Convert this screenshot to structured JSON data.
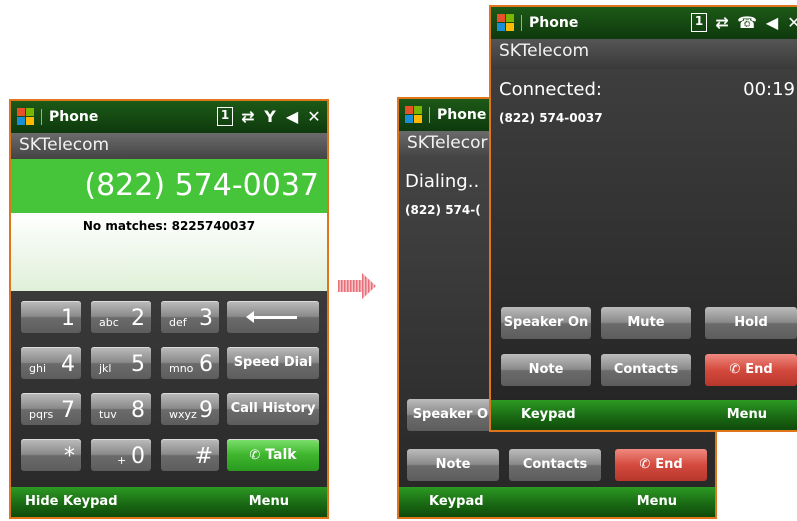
{
  "colors": {
    "accent_border": "#e0761c",
    "green_bar": "#46c53a",
    "end_red": "#d44a3e",
    "arrow_pink": "#f09aa0"
  },
  "left": {
    "title": "Phone",
    "status_icons": [
      "1",
      "⇄",
      "Y",
      "◀",
      "✕"
    ],
    "carrier": "SKTelecom",
    "dialed_number": "(822) 574-0037",
    "match_text": "No matches: 8225740037",
    "keys": [
      {
        "sub": "",
        "main": "1"
      },
      {
        "sub": "abc",
        "main": "2"
      },
      {
        "sub": "def",
        "main": "3"
      },
      {
        "sub": "ghi",
        "main": "4"
      },
      {
        "sub": "jkl",
        "main": "5"
      },
      {
        "sub": "mno",
        "main": "6"
      },
      {
        "sub": "pqrs",
        "main": "7"
      },
      {
        "sub": "tuv",
        "main": "8"
      },
      {
        "sub": "wxyz",
        "main": "9"
      },
      {
        "sub": "",
        "main": "*"
      },
      {
        "sub": "+",
        "main": "0"
      },
      {
        "sub": "",
        "main": "#"
      }
    ],
    "speed_dial": "Speed Dial",
    "call_history": "Call History",
    "talk": "Talk",
    "soft_left": "Hide Keypad",
    "soft_right": "Menu"
  },
  "back": {
    "title": "Phone",
    "carrier": "SKTelecor",
    "status": "Dialing..",
    "number": "(822) 574-(",
    "speaker": "Speaker On",
    "note": "Note",
    "contacts": "Contacts",
    "end": "End",
    "soft_left": "Keypad",
    "soft_right": "Menu"
  },
  "front": {
    "title": "Phone",
    "status_icons": [
      "1",
      "⇄",
      "☎",
      "◀",
      "✕"
    ],
    "carrier": "SKTelecom",
    "status": "Connected:",
    "timer": "00:19",
    "number": "(822) 574-0037",
    "speaker": "Speaker On",
    "mute": "Mute",
    "hold": "Hold",
    "note": "Note",
    "contacts": "Contacts",
    "end": "End",
    "soft_left": "Keypad",
    "soft_right": "Menu"
  }
}
